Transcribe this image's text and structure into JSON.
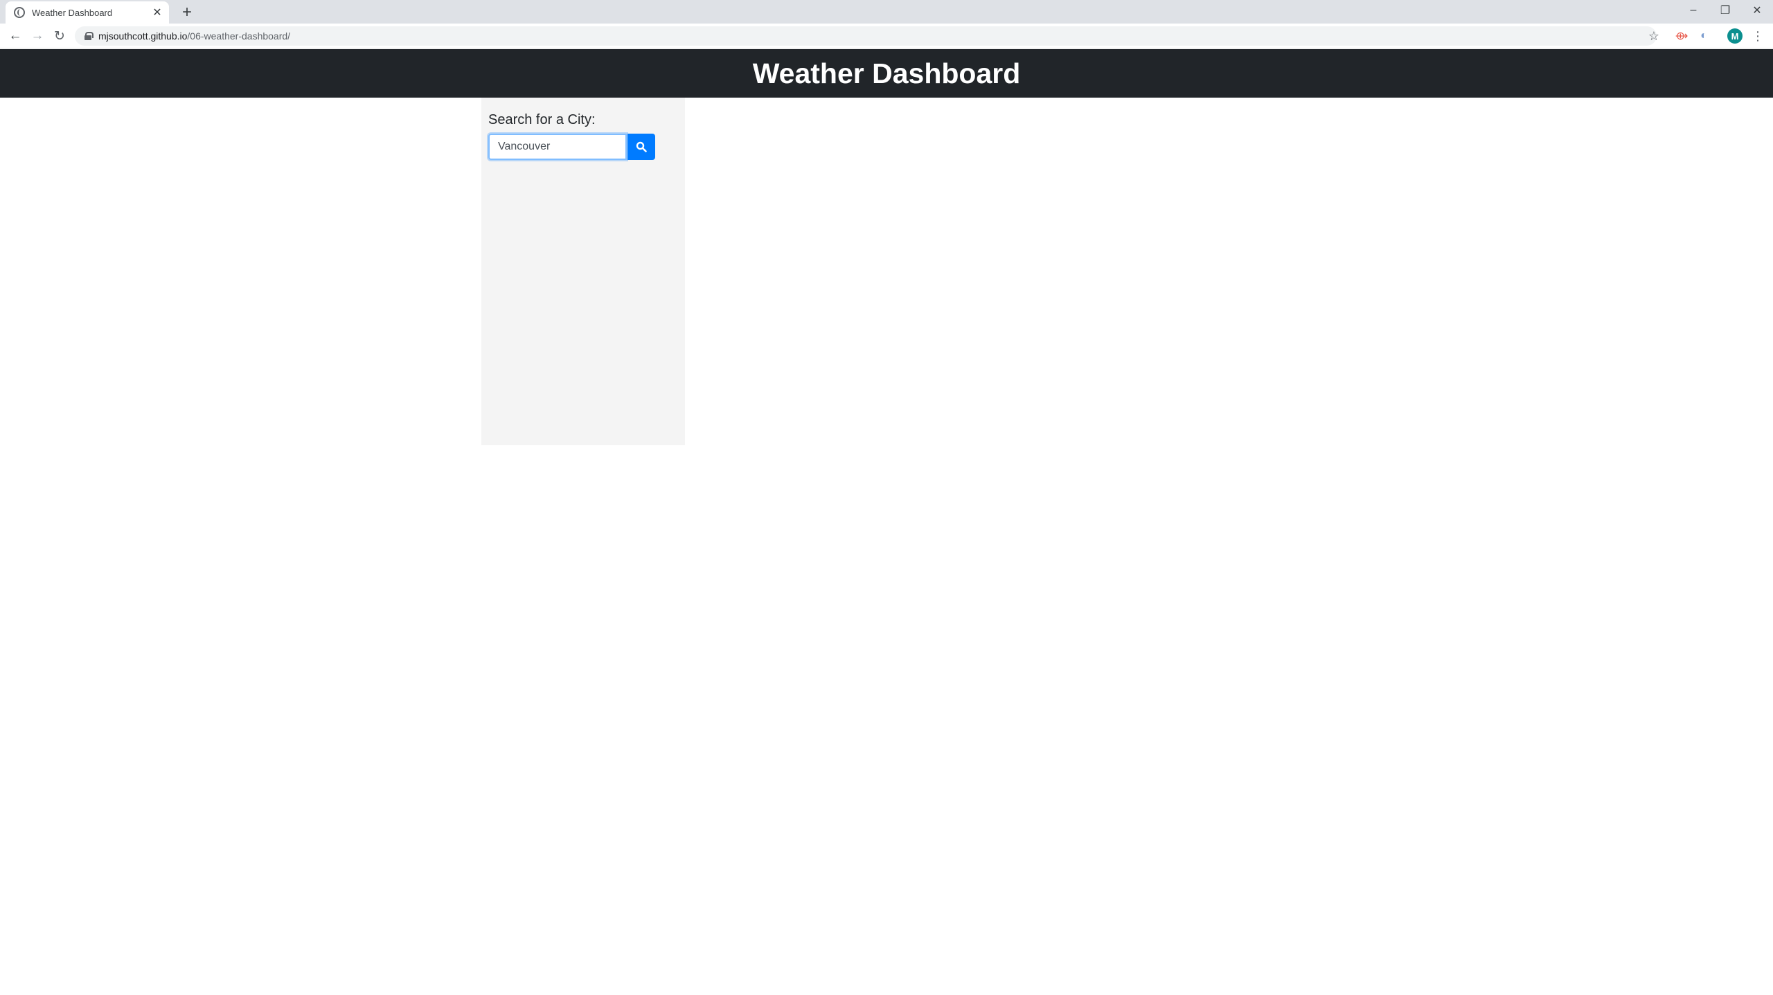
{
  "browser": {
    "tab_title": "Weather Dashboard",
    "url_host": "mjsouthcott.github.io",
    "url_path": "/06-weather-dashboard/",
    "profile_initial": "M"
  },
  "icons": {
    "tab_favicon": "globe-icon",
    "tab_close": "close-icon",
    "new_tab": "plus-icon",
    "back": "arrow-left-icon",
    "forward": "arrow-right-icon",
    "reload": "reload-icon",
    "lock": "lock-icon",
    "bookmark": "star-icon",
    "menu": "kebab-menu-icon",
    "search": "search-icon"
  },
  "header": {
    "title": "Weather Dashboard"
  },
  "sidebar": {
    "label": "Search for a City:",
    "search_value": "Vancouver"
  },
  "colors": {
    "header_bg": "#212529",
    "sidebar_bg": "#f4f4f4",
    "button_bg": "#007bff",
    "focus_border": "#80bdff"
  }
}
